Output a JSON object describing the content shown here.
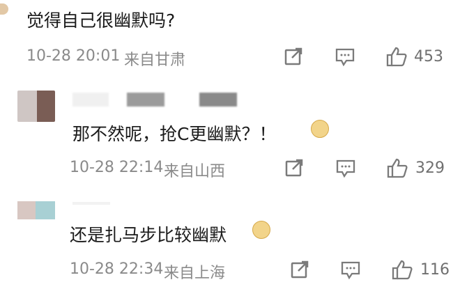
{
  "comments": [
    {
      "text": "觉得自己很幽默吗?",
      "time": "10-28 20:01",
      "location": "来自甘肃",
      "likes": "453"
    },
    {
      "text": "那不然呢，抢C更幽默？！",
      "time": "10-28 22:14",
      "location": "来自山西",
      "likes": "329"
    },
    {
      "text": "还是扎马步比较幽默",
      "time": "10-28 22:34",
      "location": "来自上海",
      "likes": "116"
    }
  ],
  "icons": {
    "share": "share-icon",
    "comment": "comment-icon",
    "like": "thumbs-up-icon",
    "emoji": "doge-emoji-icon"
  },
  "colors": {
    "text": "#1a1a1a",
    "meta": "#8a8a8a",
    "icon": "#7a7a7a",
    "divider": "#ececec"
  }
}
